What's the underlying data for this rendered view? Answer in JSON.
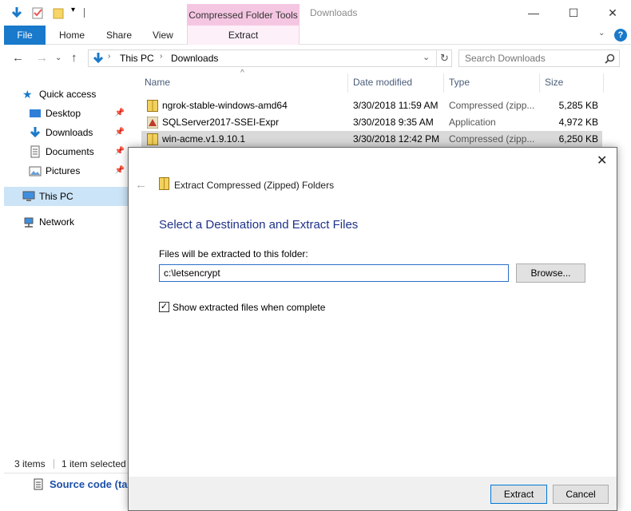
{
  "titlebar": {
    "context_tab": "Compressed Folder Tools",
    "title": "Downloads",
    "minimize": "—",
    "maximize": "☐",
    "close": "✕"
  },
  "ribbon": {
    "tabs": [
      "File",
      "Home",
      "Share",
      "View"
    ],
    "context_tab": "Extract",
    "expand": "⌄",
    "help": "?"
  },
  "navigation": {
    "path": [
      "This PC",
      "Downloads"
    ],
    "search_placeholder": "Search Downloads"
  },
  "navpane": {
    "items": [
      {
        "label": "Quick access",
        "icon": "star-icon"
      },
      {
        "label": "Desktop",
        "icon": "desktop-icon",
        "pinned": true
      },
      {
        "label": "Downloads",
        "icon": "download-icon",
        "pinned": true
      },
      {
        "label": "Documents",
        "icon": "documents-icon",
        "pinned": true
      },
      {
        "label": "Pictures",
        "icon": "pictures-icon",
        "pinned": true
      },
      {
        "label": "This PC",
        "icon": "computer-icon",
        "selected": true
      },
      {
        "label": "Network",
        "icon": "network-icon"
      }
    ]
  },
  "filelist": {
    "columns": [
      "Name",
      "Date modified",
      "Type",
      "Size"
    ],
    "rows": [
      {
        "name": "ngrok-stable-windows-amd64",
        "date": "3/30/2018 11:59 AM",
        "type": "Compressed (zipp...",
        "size": "5,285 KB",
        "icon": "zip-icon"
      },
      {
        "name": "SQLServer2017-SSEI-Expr",
        "date": "3/30/2018 9:35 AM",
        "type": "Application",
        "size": "4,972 KB",
        "icon": "installer-icon"
      },
      {
        "name": "win-acme.v1.9.10.1",
        "date": "3/30/2018 12:42 PM",
        "type": "Compressed (zipp...",
        "size": "6,250 KB",
        "icon": "zip-icon",
        "selected": true
      }
    ]
  },
  "statusbar": {
    "count": "3 items",
    "selection": "1 item selected"
  },
  "background": {
    "link_text": "Source code (ta"
  },
  "dialog": {
    "title": "Extract Compressed (Zipped) Folders",
    "heading": "Select a Destination and Extract Files",
    "dest_label": "Files will be extracted to this folder:",
    "dest_value": "c:\\letsencrypt",
    "browse": "Browse...",
    "show_label": "Show extracted files when complete",
    "show_checked": true,
    "extract": "Extract",
    "cancel": "Cancel",
    "close": "✕",
    "back": "←"
  },
  "colors": {
    "accent": "#1979ca",
    "context_tab": "#f5c6e2",
    "heading": "#1e3287"
  }
}
